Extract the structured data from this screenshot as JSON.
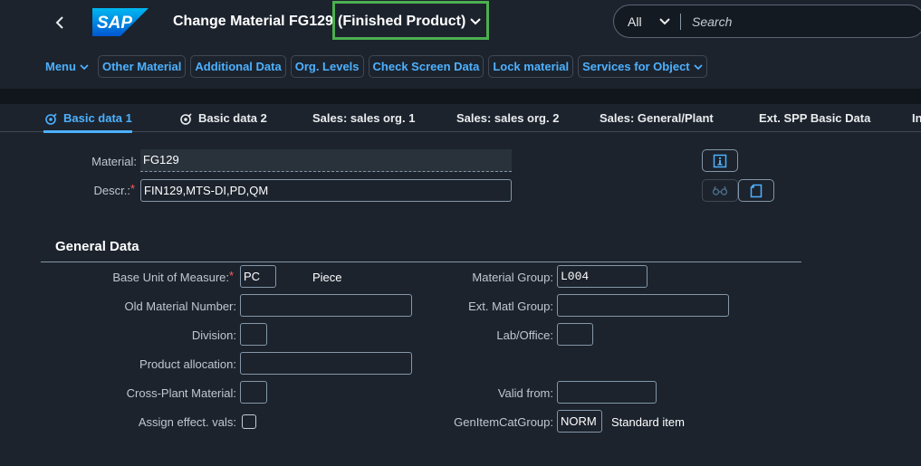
{
  "shell": {
    "back_icon": "chevron-left-icon",
    "logo_text": "SAP",
    "title": "Change Material FG129",
    "variant": "(Finished Product)",
    "search_scope": "All",
    "search_placeholder": "Search"
  },
  "toolbar": {
    "menu": "Menu",
    "other_material": "Other Material",
    "additional_data": "Additional Data",
    "org_levels": "Org. Levels",
    "check_screen_data": "Check Screen Data",
    "lock_material": "Lock material",
    "services_for_object": "Services for Object"
  },
  "tabs": [
    {
      "label": "Basic data 1",
      "icon": "target-icon"
    },
    {
      "label": "Basic data 2",
      "icon": "target-icon"
    },
    {
      "label": "Sales: sales org. 1"
    },
    {
      "label": "Sales: sales org. 2"
    },
    {
      "label": "Sales: General/Plant"
    },
    {
      "label": "Ext. SPP Basic Data"
    },
    {
      "label": "In"
    }
  ],
  "header": {
    "material_label": "Material:",
    "material_value": "FG129",
    "descr_label": "Descr.:",
    "descr_value": "FIN129,MTS-DI,PD,QM",
    "required_mark": "*"
  },
  "general": {
    "title": "General Data",
    "base_uom_label": "Base Unit of Measure:",
    "base_uom_value": "PC",
    "base_uom_text": "Piece",
    "material_group_label": "Material Group:",
    "material_group_value": "L004",
    "old_material_label": "Old Material Number:",
    "old_material_value": "",
    "ext_matl_group_label": "Ext. Matl Group:",
    "ext_matl_group_value": "",
    "division_label": "Division:",
    "division_value": "",
    "lab_office_label": "Lab/Office:",
    "lab_office_value": "",
    "product_allocation_label": "Product allocation:",
    "product_allocation_value": "",
    "cross_plant_label": "Cross-Plant Material:",
    "cross_plant_value": "",
    "valid_from_label": "Valid from:",
    "valid_from_value": "",
    "assign_effect_label": "Assign effect. vals:",
    "gen_item_cat_label": "GenItemCatGroup:",
    "gen_item_cat_value": "NORM",
    "gen_item_cat_text": "Standard item"
  },
  "colors": {
    "accent": "#4db1ff",
    "highlight_box": "#4caf50",
    "required": "#ff5e5e",
    "background": "#1c232d"
  }
}
